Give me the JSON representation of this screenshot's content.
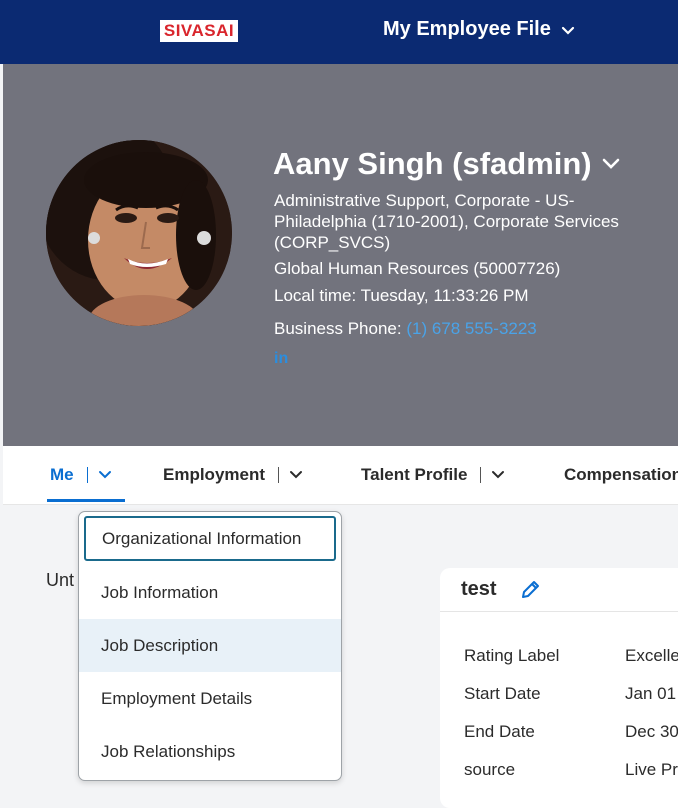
{
  "topbar": {
    "logo_text": "SIVASAI",
    "app_title": "My Employee File",
    "bg_color": "#0b2a72"
  },
  "profile": {
    "name": "Aany Singh (sfadmin)",
    "position": "Administrative Support, Corporate - US-Philadelphia (1710-2001), Corporate Services (CORP_SVCS)",
    "department": "Global Human Resources (50007726)",
    "local_time_label": "Local time:",
    "local_time": "Tuesday, 11:33:26 PM",
    "phone_label": "Business Phone:",
    "phone": "(1) 678 555-3223",
    "linkedin": "in"
  },
  "tabs": [
    {
      "label": "Me",
      "active": true
    },
    {
      "label": "Employment",
      "active": false
    },
    {
      "label": "Talent Profile",
      "active": false
    },
    {
      "label": "Compensation",
      "active": false
    }
  ],
  "dropdown": {
    "items": [
      {
        "label": "Organizational Information",
        "state": "focused"
      },
      {
        "label": "Job Information",
        "state": "normal"
      },
      {
        "label": "Job Description",
        "state": "hover"
      },
      {
        "label": "Employment Details",
        "state": "normal"
      },
      {
        "label": "Job Relationships",
        "state": "normal"
      }
    ]
  },
  "content": {
    "until_text": "Unt"
  },
  "card": {
    "title": "test",
    "rows": [
      {
        "label": "Rating Label",
        "value": "Excelle"
      },
      {
        "label": "Start Date",
        "value": "Jan 01"
      },
      {
        "label": "End Date",
        "value": "Dec 30"
      },
      {
        "label": "source",
        "value": "Live Pr"
      }
    ]
  }
}
